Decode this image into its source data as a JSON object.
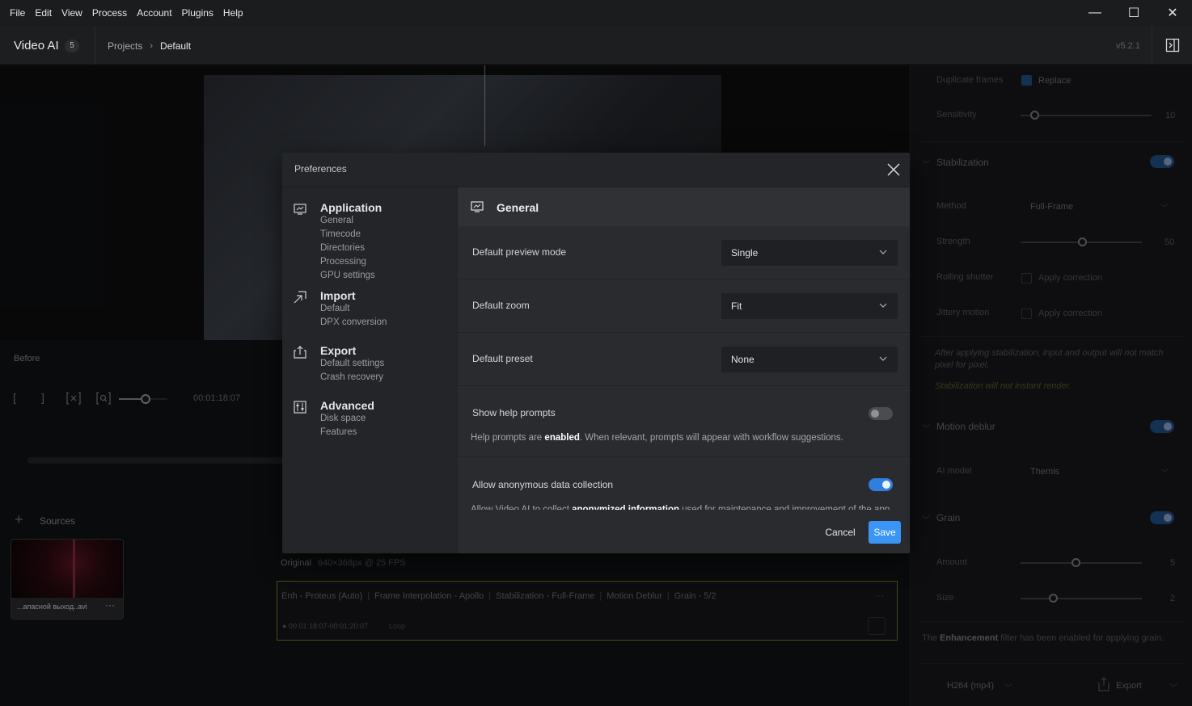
{
  "menu": [
    "File",
    "Edit",
    "View",
    "Process",
    "Account",
    "Plugins",
    "Help"
  ],
  "window_controls": {
    "minimize": "—",
    "maximize": "☐",
    "close": "✕"
  },
  "header": {
    "app_title": "Video AI",
    "badge": "5",
    "crumb_projects": "Projects",
    "crumb_separator": "›",
    "crumb_current": "Default",
    "version": "v5.2.1"
  },
  "viewer": {
    "before_label": "Before",
    "timecode": "00:01:18:07"
  },
  "timeline": {
    "zoom_level": 0.55
  },
  "sources": {
    "plus": "+",
    "label": "Sources",
    "thumb_name": "...апасной выход..avi",
    "more": "···"
  },
  "output": {
    "label": "Original",
    "spec": "640×368px @ 25 FPS"
  },
  "export_card": {
    "filters": [
      "Enh - Proteus (Auto)",
      "Frame Interpolation - Apollo",
      "Stabilization - Full-Frame",
      "Motion Deblur",
      "Grain - 5/2"
    ],
    "separator": "|",
    "more": "···",
    "status": "● 00:01:18:07-00:01:20:07",
    "loop": "Loop"
  },
  "right_panel": {
    "duplicate_frames_label": "Duplicate frames",
    "duplicate_frames_value": "Replace",
    "sensitivity_label": "Sensitivity",
    "sensitivity_value": "10",
    "stabilization_label": "Stabilization",
    "method_label": "Method",
    "method_value": "Full-Frame",
    "strength_label": "Strength",
    "strength_value": "50",
    "rolling_shutter_label": "Rolling shutter",
    "rolling_shutter_value": "Apply correction",
    "jittery_motion_label": "Jittery motion",
    "jittery_motion_value": "Apply correction",
    "stabilization_note": "After applying stabilization, input and output will not match pixel for pixel.",
    "stabilization_warning": "Stabilization will not instant render.",
    "motion_deblur_label": "Motion deblur",
    "ai_model_label": "AI model",
    "ai_model_value": "Themis",
    "grain_label": "Grain",
    "amount_label": "Amount",
    "amount_value": "5",
    "size_label": "Size",
    "size_value": "2",
    "enhancement_note_pre": "The",
    "enhancement_note_bold": "Enhancement",
    "enhancement_note_post": "filter has been enabled for applying grain.",
    "format_value": "H264 (mp4)",
    "export_label": "Export"
  },
  "modal": {
    "title": "Preferences",
    "nav": [
      {
        "title": "Application",
        "items": [
          "General",
          "Timecode",
          "Directories",
          "Processing",
          "GPU settings"
        ]
      },
      {
        "title": "Import",
        "items": [
          "Default",
          "DPX conversion"
        ]
      },
      {
        "title": "Export",
        "items": [
          "Default settings",
          "Crash recovery"
        ]
      },
      {
        "title": "Advanced",
        "items": [
          "Disk space",
          "Features"
        ]
      }
    ],
    "content_title": "General",
    "preview_mode_label": "Default preview mode",
    "preview_mode_value": "Single",
    "zoom_label": "Default zoom",
    "zoom_value": "Fit",
    "preset_label": "Default preset",
    "preset_value": "None",
    "help_prompts_label": "Show help prompts",
    "help_prompts_enabled": false,
    "help_prompts_desc_pre": "Help prompts are",
    "help_prompts_desc_bold": "enabled",
    "help_prompts_desc_post": ". When relevant, prompts will appear with workflow suggestions.",
    "data_collection_label": "Allow anonymous data collection",
    "data_collection_enabled": true,
    "data_collection_desc_pre": "Allow Video AI to collect",
    "data_collection_desc_bold": "anonymized information",
    "data_collection_desc_post": "used for maintenance and improvement of the app.",
    "cancel_label": "Cancel",
    "save_label": "Save"
  },
  "colors": {
    "accent": "#3a95f4",
    "toggle_on": "#2f7fe0",
    "card_border": "#6b7a2a",
    "warning": "#6f6a1a"
  }
}
